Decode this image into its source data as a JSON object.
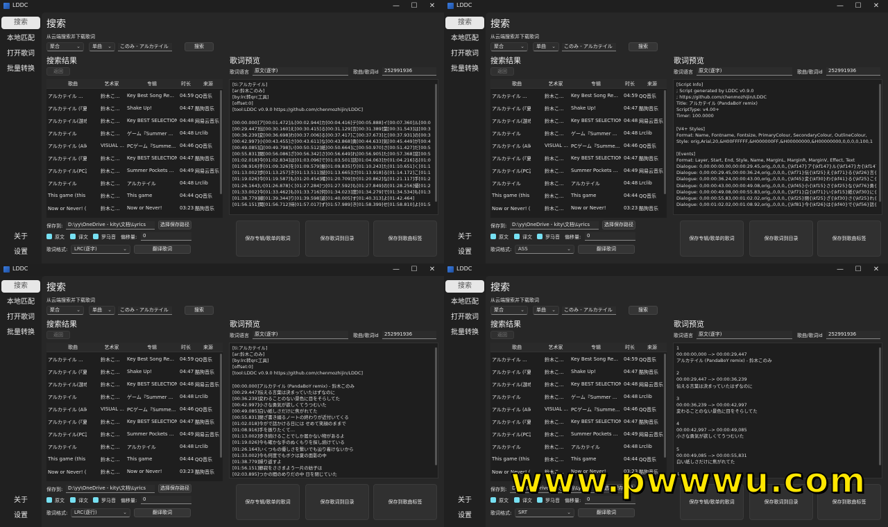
{
  "app": {
    "title": "LDDC",
    "min": "—",
    "max": "☐",
    "close": "✕"
  },
  "sidebar": {
    "search": "搜索",
    "local": "本地匹配",
    "open": "打开歌词",
    "batch": "批量转换",
    "about": "关于",
    "settings": "设置"
  },
  "search": {
    "heading": "搜索",
    "desc": "从云端搜索并下载歌词",
    "source": "聚合",
    "type": "单曲",
    "keyword": "このみ - アルカテイル",
    "button": "搜索"
  },
  "results": {
    "heading": "搜索结果",
    "back": "返回",
    "columns": [
      "歌曲",
      "艺术家",
      "专辑",
      "时长",
      "来源"
    ],
    "rows": [
      [
        "アルカテイル ...",
        "鈴木こ...",
        "Key Best Song Re...",
        "04:59",
        "QQ音乐"
      ],
      [
        "アルカテイル (『夏...",
        "鈴木こ...",
        "Shake Up!",
        "04:47",
        "酷狗音乐"
      ],
      [
        "アルカテイル(游戏...",
        "鈴木こ...",
        "Key BEST SELECTION",
        "04:48",
        "网易云音乐"
      ],
      [
        "アルカテイル",
        "鈴木こ...",
        "ゲーム『Summer ...",
        "04:48",
        "Lrclib"
      ],
      [
        "アルカテイル (Alka ...",
        "VISUAL ...",
        "PCゲーム『Summe...",
        "04:46",
        "QQ音乐"
      ],
      [
        "アルカテイル (『夏...",
        "鈴木こ...",
        "Key BEST SELECTION",
        "04:47",
        "酷狗音乐"
      ],
      [
        "アルカテイル(PC游...",
        "鈴木こ...",
        "Summer Pockets ...",
        "04:49",
        "网易云音乐"
      ],
      [
        "アルカテイル",
        "鈴木こ...",
        "アルカテイル",
        "04:48",
        "Lrclib"
      ],
      [
        "This game (this ...",
        "鈴木こ...",
        "This game",
        "04:44",
        "QQ音乐"
      ],
      [
        "Now or Never! (『...",
        "鈴木こ...",
        "Now or Never!",
        "03:23",
        "酷狗音乐"
      ]
    ]
  },
  "bottom": {
    "save_path_label": "保存到:",
    "save_path": "D:\\yy\\OneDrive - kity\\文档\\Lyrics",
    "choose_path": "选择保存路径",
    "orig": "原文",
    "trans": "译文",
    "roma": "罗马音",
    "offset_label": "偏移量:",
    "offset_value": "0",
    "format_label": "歌词格式:",
    "translate": "翻译歌词"
  },
  "preview": {
    "heading": "歌词预览",
    "lang_label": "歌词语言",
    "lang_value": "原文(逐字)",
    "id_label": "歌曲/歌词id",
    "id_value": "252991936",
    "save_album": "保存专辑/歌单的歌词",
    "save_dir": "保存歌词到目录",
    "save_tag": "保存到歌曲标签"
  },
  "panels": [
    {
      "lang": "原文(逐字)",
      "format": "LRC(逐字)",
      "text": "[ti:アルカテイル]\n[ar:鈴木このみ]\n[by:lrc转qrc工具]\n[offset:0]\n[tool:LDDC v0.9.0 https://github.com/chenmozhijin/LDDC]\n\n[00:00.000]ア[00:01.472]ル[00:02.944]カ[00:04.416]テ[00:05.888]イ[00:07.360]ル[00:0\n[00:29.447]伝[00:30.160]え[00:30.415]る[00:31.129]言[00:31.389]葉[00:31.543]は[00:3\n[00:36.239]変[00:36.698]わ[00:37.006]る[00:37.417]こ[00:37.673]と[00:37.931]の[00:3\n[00:42.997]小[00:43.455]さ[00:43.611]な[00:43.868]勇[00:44.633]気[00:45.449]が[00:4\n[00:49.085]白[00:49.798]い[00:50.512]紙[00:50.664]に[00:50.970]さ[00:51.427]だ[00:5\n[00:55.831]閉[00:56.086]ざ[00:56.342]さ[00:56.649]れ[00:56.905]た[00:57.368]窓[00:5\n[01:02.018]今[01:02.834]は[01:03.096]で[01:03.501]話[01:04.063]か[01:04.216]る[01:0\n[01:08.916]手[01:09.326]を[01:09.579]振[01:09.835]り[01:10.243]た[01:10.651]く[01:1\n[01:13.002]歩[01:13.257]き[01:13.511]続[01:13.665]け[01:13.918]る[01:14.172]こ[01:1\n[01:19.026]今[01:19.587]も[01:20.454]確[01:20.709]か[01:20.862]な[01:21.117]手[01:2\n[01:26.164]い[01:26.878]く[01:27.284]つ[01:27.592]も[01:27.849]の[01:28.256]優[01:2\n[01:33.002]今[01:33.462]も[01:33.716]何[01:34.023]度[01:34.279]で[01:34.534]も[01:3\n[01:38.779]線[01:39.344]り[01:39.598]返[01:40.005]す[01:40.313]よ[01:42.464]\n[01:56.151]聞[01:56.712]待[01:57.017]ず[01:57.989]き[01:58.399]せ[01:58.810]よ[01:5"
    },
    {
      "lang": "原文(逐字)",
      "format": "ASS",
      "text": "[Script Info]\n; Script generated by LDDC v0.9.0\n; https://github.com/chenmozhijin/LDDC\nTitle: アルカテイル (PandaBoY remix)\nScriptType: v4.00+\nTimer: 100.0000\n\n[V4+ Styles]\nFormat: Name, Fontname, Fontsize, PrimaryColour, SecondaryColour, OutlineColour, \nStyle: orig,Arial,20,&H00FFFFFF,&H000000FF,&H00000000,&H00000000,0,0,0,0,100,1\n\n[Events]\nFormat: Layer, Start, End, Style, Name, MarginL, MarginR, MarginV, Effect, Text\nDialogue: 0,00:00:00.00,00:00:29.45,orig,,0,0,0,,{\\kf147}ア{\\kf147}ル{\\kf147}カ{\\kf147}\nDialogue: 0,00:00:29.45,00:00:36.24,orig,,0,0,0,,{\\kf71}伝{\\kf25}え{\\kf71}る{\\kf26}言{\\k\nDialogue: 0,00:00:36.24,00:00:43.00,orig,,0,0,0,,{\\kf45}変{\\kf30}わ{\\kf41}る{\\kf25}こ{\\k\nDialogue: 0,00:00:43.00,00:00:49.08,orig,,0,0,0,,{\\kf45}小{\\kf15}さ{\\kf25}な{\\kf76}勇{\\k\nDialogue: 0,00:00:49.08,00:00:55.83,orig,,0,0,0,,{\\kf71}白{\\kf71}い{\\kf15}紙{\\kf30}に{\\k\nDialogue: 0,00:00:55.83,00:01:02.02,orig,,0,0,0,,{\\kf25}閉{\\kf25}ざ{\\kf30}さ{\\kf25}れ{\\k\nDialogue: 0,00:01:02.02,00:01:08.92,orig,,0,0,0,,{\\kf81}今{\\kf26}は{\\kf40}で{\\kf56}話{\\k"
    },
    {
      "lang": "原文(逐字)",
      "format": "LRC(逐行)",
      "text": "[ti:アルカテイル]\n[ar:鈴木このみ]\n[by:lrc转qrc工具]\n[offset:0]\n[tool:LDDC v0.9.0 https://github.com/chenmozhijin/LDDC]\n\n[00:00.000]アルカテイル (PandaBoY remix) - 鈴木このみ\n[00:29.447]伝える言葉は決まっていたはずなのに\n[00:36.239]変わることのない景色に目をそらしてた\n[00:42.997]小さな勇気が欲しくてうつむいた\n[00:49.085]白い紙しさだけに焦がれてた\n[00:55.831]閉ざ書き綴るノートの終わりが近付いてくる\n[01:02.018]今がで話かける日には せめて笑顔のままで\n[01:08.916]手を振りたくて…\n[01:13.002]歩き続けることでしか届かない物があるよ\n[01:19.026]今も確かな手のぬくもりを探し続けている\n[01:26.164]いくつもの優しさを繋いでも辿り着けないから\n[01:33.002]今も何度でもボクは夏の面影の中\n[01:38.779]繰り返すよ\n[01:56.151]静寂をささまよう一片の妨子は\n[02:03.895]つかの間のめりだの中 日を閉じていた"
    },
    {
      "lang": "原文(逐字)",
      "format": "SRT",
      "text": "1\n00:00:00,000 --> 00:00:29,447\nアルカテイル (PandaBoY remix) - 鈴木このみ\n\n2\n00:00:29,447 --> 00:00:36,239\n伝える言葉は決まっていたはずなのに\n\n3\n00:00:36,239 --> 00:00:42,997\n変わることのない景色に目をそらしてた\n\n4\n00:00:42,997 --> 00:00:49,085\n小さな勇気が欲しくてうつむいた\n\n5\n00:00:49,085 --> 00:00:55,831\n白い紙しさだけに焦がれてた\n\n6"
    }
  ],
  "watermark": "www.pwwwu.com"
}
